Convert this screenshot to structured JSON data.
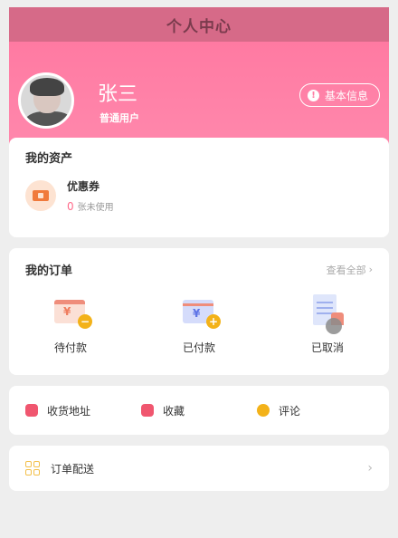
{
  "navbar": {
    "title": "个人中心"
  },
  "profile": {
    "name": "张三",
    "role": "普通用户",
    "info_button": "基本信息"
  },
  "assets": {
    "title": "我的资产",
    "coupon": {
      "name": "优惠券",
      "count": "0",
      "status": "张未使用"
    }
  },
  "orders": {
    "title": "我的订单",
    "see_all": "查看全部",
    "items": [
      {
        "label": "待付款",
        "icon": "pending-payment-icon"
      },
      {
        "label": "已付款",
        "icon": "paid-icon"
      },
      {
        "label": "已取消",
        "icon": "cancelled-icon"
      }
    ]
  },
  "links": [
    {
      "label": "收货地址",
      "icon": "address-icon",
      "color": "#f0566f"
    },
    {
      "label": "收藏",
      "icon": "favorites-icon",
      "color": "#f0566f"
    },
    {
      "label": "评论",
      "icon": "comment-icon",
      "color": "#f3b219"
    }
  ],
  "delivery": {
    "label": "订单配送"
  },
  "colors": {
    "brand": "#ff7aa2",
    "navbar": "#d66a88"
  }
}
